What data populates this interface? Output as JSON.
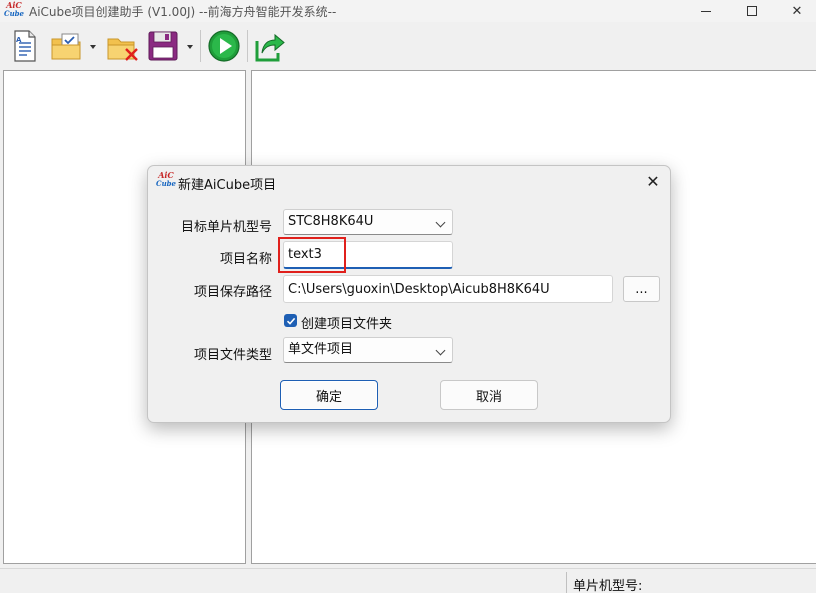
{
  "window": {
    "title": "AiCube项目创建助手 (V1.00J) --前海方舟智能开发系统--",
    "logo_top": "AiC",
    "logo_bottom": "Cube"
  },
  "toolbar": {
    "items": [
      {
        "name": "new-document-icon"
      },
      {
        "name": "open-folder-icon"
      },
      {
        "name": "close-folder-icon"
      },
      {
        "name": "save-icon"
      },
      {
        "name": "run-icon"
      },
      {
        "name": "export-icon"
      }
    ]
  },
  "dialog": {
    "title": "新建AiCube项目",
    "logo_top": "AiC",
    "logo_bottom": "Cube",
    "fields": {
      "mcu_label": "目标单片机型号",
      "mcu_value": "STC8H8K64U",
      "name_label": "项目名称",
      "name_value": "text3",
      "path_label": "项目保存路径",
      "path_value": "C:\\Users\\guoxin\\Desktop\\Aicub8H8K64U",
      "browse_label": "...",
      "create_folder_label": "创建项目文件夹",
      "create_folder_checked": true,
      "type_label": "项目文件类型",
      "type_value": "单文件项目"
    },
    "buttons": {
      "ok": "确定",
      "cancel": "取消"
    }
  },
  "statusbar": {
    "mcu_label": "单片机型号:"
  },
  "colors": {
    "accent": "#1e5fb4",
    "highlight": "#e0201c"
  }
}
